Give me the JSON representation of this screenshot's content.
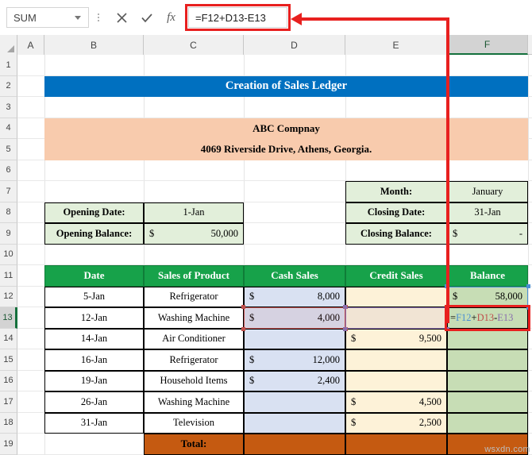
{
  "formula_bar": {
    "name_box": "SUM",
    "cancel_icon": "close-icon",
    "confirm_icon": "check-icon",
    "function_icon": "fx-icon",
    "formula": "=F12+D13-E13",
    "highlight_color": "#e8201f"
  },
  "columns": [
    "A",
    "B",
    "C",
    "D",
    "E",
    "F"
  ],
  "active_column": "F",
  "active_row": "13",
  "rows": [
    "1",
    "2",
    "3",
    "4",
    "5",
    "6",
    "7",
    "8",
    "9",
    "10",
    "11",
    "12",
    "13",
    "14",
    "15",
    "16",
    "17",
    "18",
    "19"
  ],
  "sheet": {
    "title_banner": "Creation of Sales Ledger",
    "company_name": "ABC Compnay",
    "company_address": "4069 Riverside Drive, Athens, Georgia.",
    "opening": {
      "date_label": "Opening Date:",
      "date_value": "1-Jan",
      "balance_label": "Opening Balance:",
      "balance_currency": "$",
      "balance_value": "50,000"
    },
    "closing": {
      "month_label": "Month:",
      "month_value": "January",
      "date_label": "Closing Date:",
      "date_value": "31-Jan",
      "balance_label": "Closing Balance:",
      "balance_currency": "$",
      "balance_value": "-"
    },
    "table": {
      "headers": [
        "Date",
        "Sales of Product",
        "Cash Sales",
        "Credit Sales",
        "Balance"
      ],
      "rows": [
        {
          "date": "5-Jan",
          "product": "Refrigerator",
          "cash_currency": "$",
          "cash": "8,000",
          "credit_currency": "",
          "credit": "",
          "balance_currency": "$",
          "balance": "58,000"
        },
        {
          "date": "12-Jan",
          "product": "Washing Machine",
          "cash_currency": "$",
          "cash": "4,000",
          "credit_currency": "",
          "credit": "",
          "balance_currency": "",
          "balance": "",
          "balance_formula": [
            {
              "t": "=",
              "c": "plain"
            },
            {
              "t": "F12",
              "c": "blue"
            },
            {
              "t": "+",
              "c": "plain"
            },
            {
              "t": "D13",
              "c": "red"
            },
            {
              "t": "-",
              "c": "plain"
            },
            {
              "t": "E13",
              "c": "purple"
            }
          ]
        },
        {
          "date": "14-Jan",
          "product": "Air Conditioner",
          "cash_currency": "",
          "cash": "",
          "credit_currency": "$",
          "credit": "9,500",
          "balance_currency": "",
          "balance": ""
        },
        {
          "date": "16-Jan",
          "product": "Refrigerator",
          "cash_currency": "$",
          "cash": "12,000",
          "credit_currency": "",
          "credit": "",
          "balance_currency": "",
          "balance": ""
        },
        {
          "date": "19-Jan",
          "product": "Household Items",
          "cash_currency": "$",
          "cash": "2,400",
          "credit_currency": "",
          "credit": "",
          "balance_currency": "",
          "balance": ""
        },
        {
          "date": "26-Jan",
          "product": "Washing Machine",
          "cash_currency": "",
          "cash": "",
          "credit_currency": "$",
          "credit": "4,500",
          "balance_currency": "",
          "balance": ""
        },
        {
          "date": "31-Jan",
          "product": "Television",
          "cash_currency": "",
          "cash": "",
          "credit_currency": "$",
          "credit": "2,500",
          "balance_currency": "",
          "balance": ""
        }
      ],
      "total_label": "Total:",
      "total_cash": "",
      "total_credit": "",
      "total_balance": ""
    }
  },
  "colors": {
    "banner_blue": "#0070c0",
    "company_peach": "#f8cbad",
    "info_green": "#e2efda",
    "header_green": "#17a24a",
    "cash_blue": "#d9e1f2",
    "credit_yellow": "#fdf2d8",
    "balance_green": "#c7ddb5",
    "total_orange": "#c55a11",
    "annotation_red": "#e8201f",
    "ref_f12_blue": "#4a8fd4",
    "ref_d13_red": "#c0504d",
    "ref_e13_purple": "#8a6fae"
  },
  "watermark": "wsxdn.com"
}
